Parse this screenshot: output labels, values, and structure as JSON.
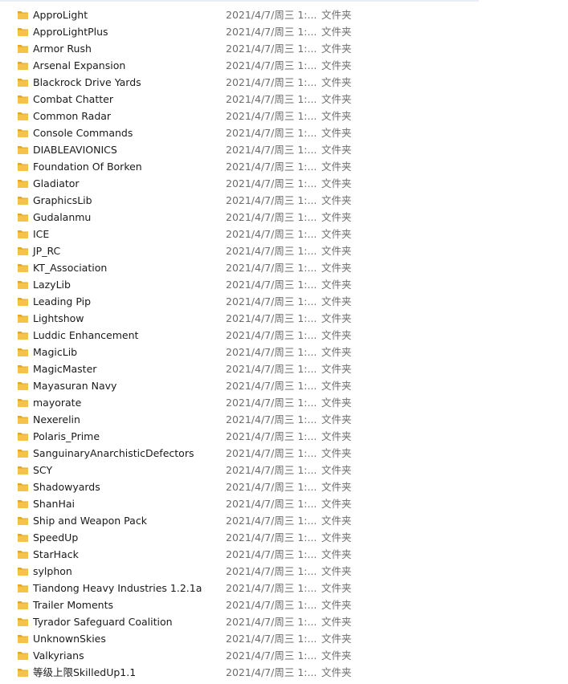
{
  "colors": {
    "folder_icon": "#f5c24a",
    "folder_icon_back": "#e3a820",
    "text": "#1a1a1a",
    "secondary_text": "#6d6d6d"
  },
  "folders": [
    {
      "name": "ApproLight",
      "modified": "2021/4/7/周三 1:...",
      "type": "文件夹"
    },
    {
      "name": "ApproLightPlus",
      "modified": "2021/4/7/周三 1:...",
      "type": "文件夹"
    },
    {
      "name": "Armor Rush",
      "modified": "2021/4/7/周三 1:...",
      "type": "文件夹"
    },
    {
      "name": "Arsenal Expansion",
      "modified": "2021/4/7/周三 1:...",
      "type": "文件夹"
    },
    {
      "name": "Blackrock Drive Yards",
      "modified": "2021/4/7/周三 1:...",
      "type": "文件夹"
    },
    {
      "name": "Combat Chatter",
      "modified": "2021/4/7/周三 1:...",
      "type": "文件夹"
    },
    {
      "name": "Common Radar",
      "modified": "2021/4/7/周三 1:...",
      "type": "文件夹"
    },
    {
      "name": "Console Commands",
      "modified": "2021/4/7/周三 1:...",
      "type": "文件夹"
    },
    {
      "name": "DIABLEAVIONICS",
      "modified": "2021/4/7/周三 1:...",
      "type": "文件夹"
    },
    {
      "name": "Foundation Of Borken",
      "modified": "2021/4/7/周三 1:...",
      "type": "文件夹"
    },
    {
      "name": "Gladiator",
      "modified": "2021/4/7/周三 1:...",
      "type": "文件夹"
    },
    {
      "name": "GraphicsLib",
      "modified": "2021/4/7/周三 1:...",
      "type": "文件夹"
    },
    {
      "name": "Gudalanmu",
      "modified": "2021/4/7/周三 1:...",
      "type": "文件夹"
    },
    {
      "name": "ICE",
      "modified": "2021/4/7/周三 1:...",
      "type": "文件夹"
    },
    {
      "name": "JP_RC",
      "modified": "2021/4/7/周三 1:...",
      "type": "文件夹"
    },
    {
      "name": "KT_Association",
      "modified": "2021/4/7/周三 1:...",
      "type": "文件夹"
    },
    {
      "name": "LazyLib",
      "modified": "2021/4/7/周三 1:...",
      "type": "文件夹"
    },
    {
      "name": "Leading Pip",
      "modified": "2021/4/7/周三 1:...",
      "type": "文件夹"
    },
    {
      "name": "Lightshow",
      "modified": "2021/4/7/周三 1:...",
      "type": "文件夹"
    },
    {
      "name": "Luddic Enhancement",
      "modified": "2021/4/7/周三 1:...",
      "type": "文件夹"
    },
    {
      "name": "MagicLib",
      "modified": "2021/4/7/周三 1:...",
      "type": "文件夹"
    },
    {
      "name": "MagicMaster",
      "modified": "2021/4/7/周三 1:...",
      "type": "文件夹"
    },
    {
      "name": "Mayasuran Navy",
      "modified": "2021/4/7/周三 1:...",
      "type": "文件夹"
    },
    {
      "name": "mayorate",
      "modified": "2021/4/7/周三 1:...",
      "type": "文件夹"
    },
    {
      "name": "Nexerelin",
      "modified": "2021/4/7/周三 1:...",
      "type": "文件夹"
    },
    {
      "name": "Polaris_Prime",
      "modified": "2021/4/7/周三 1:...",
      "type": "文件夹"
    },
    {
      "name": "SanguinaryAnarchisticDefectors",
      "modified": "2021/4/7/周三 1:...",
      "type": "文件夹"
    },
    {
      "name": "SCY",
      "modified": "2021/4/7/周三 1:...",
      "type": "文件夹"
    },
    {
      "name": "Shadowyards",
      "modified": "2021/4/7/周三 1:...",
      "type": "文件夹"
    },
    {
      "name": "ShanHai",
      "modified": "2021/4/7/周三 1:...",
      "type": "文件夹"
    },
    {
      "name": "Ship and Weapon Pack",
      "modified": "2021/4/7/周三 1:...",
      "type": "文件夹"
    },
    {
      "name": "SpeedUp",
      "modified": "2021/4/7/周三 1:...",
      "type": "文件夹"
    },
    {
      "name": "StarHack",
      "modified": "2021/4/7/周三 1:...",
      "type": "文件夹"
    },
    {
      "name": "sylphon",
      "modified": "2021/4/7/周三 1:...",
      "type": "文件夹"
    },
    {
      "name": "Tiandong Heavy Industries 1.2.1a",
      "modified": "2021/4/7/周三 1:...",
      "type": "文件夹"
    },
    {
      "name": "Trailer Moments",
      "modified": "2021/4/7/周三 1:...",
      "type": "文件夹"
    },
    {
      "name": "Tyrador Safeguard Coalition",
      "modified": "2021/4/7/周三 1:...",
      "type": "文件夹"
    },
    {
      "name": "UnknownSkies",
      "modified": "2021/4/7/周三 1:...",
      "type": "文件夹"
    },
    {
      "name": "Valkyrians",
      "modified": "2021/4/7/周三 1:...",
      "type": "文件夹"
    },
    {
      "name": "等级上限SkilledUp1.1",
      "modified": "2021/4/7/周三 1:...",
      "type": "文件夹"
    }
  ]
}
